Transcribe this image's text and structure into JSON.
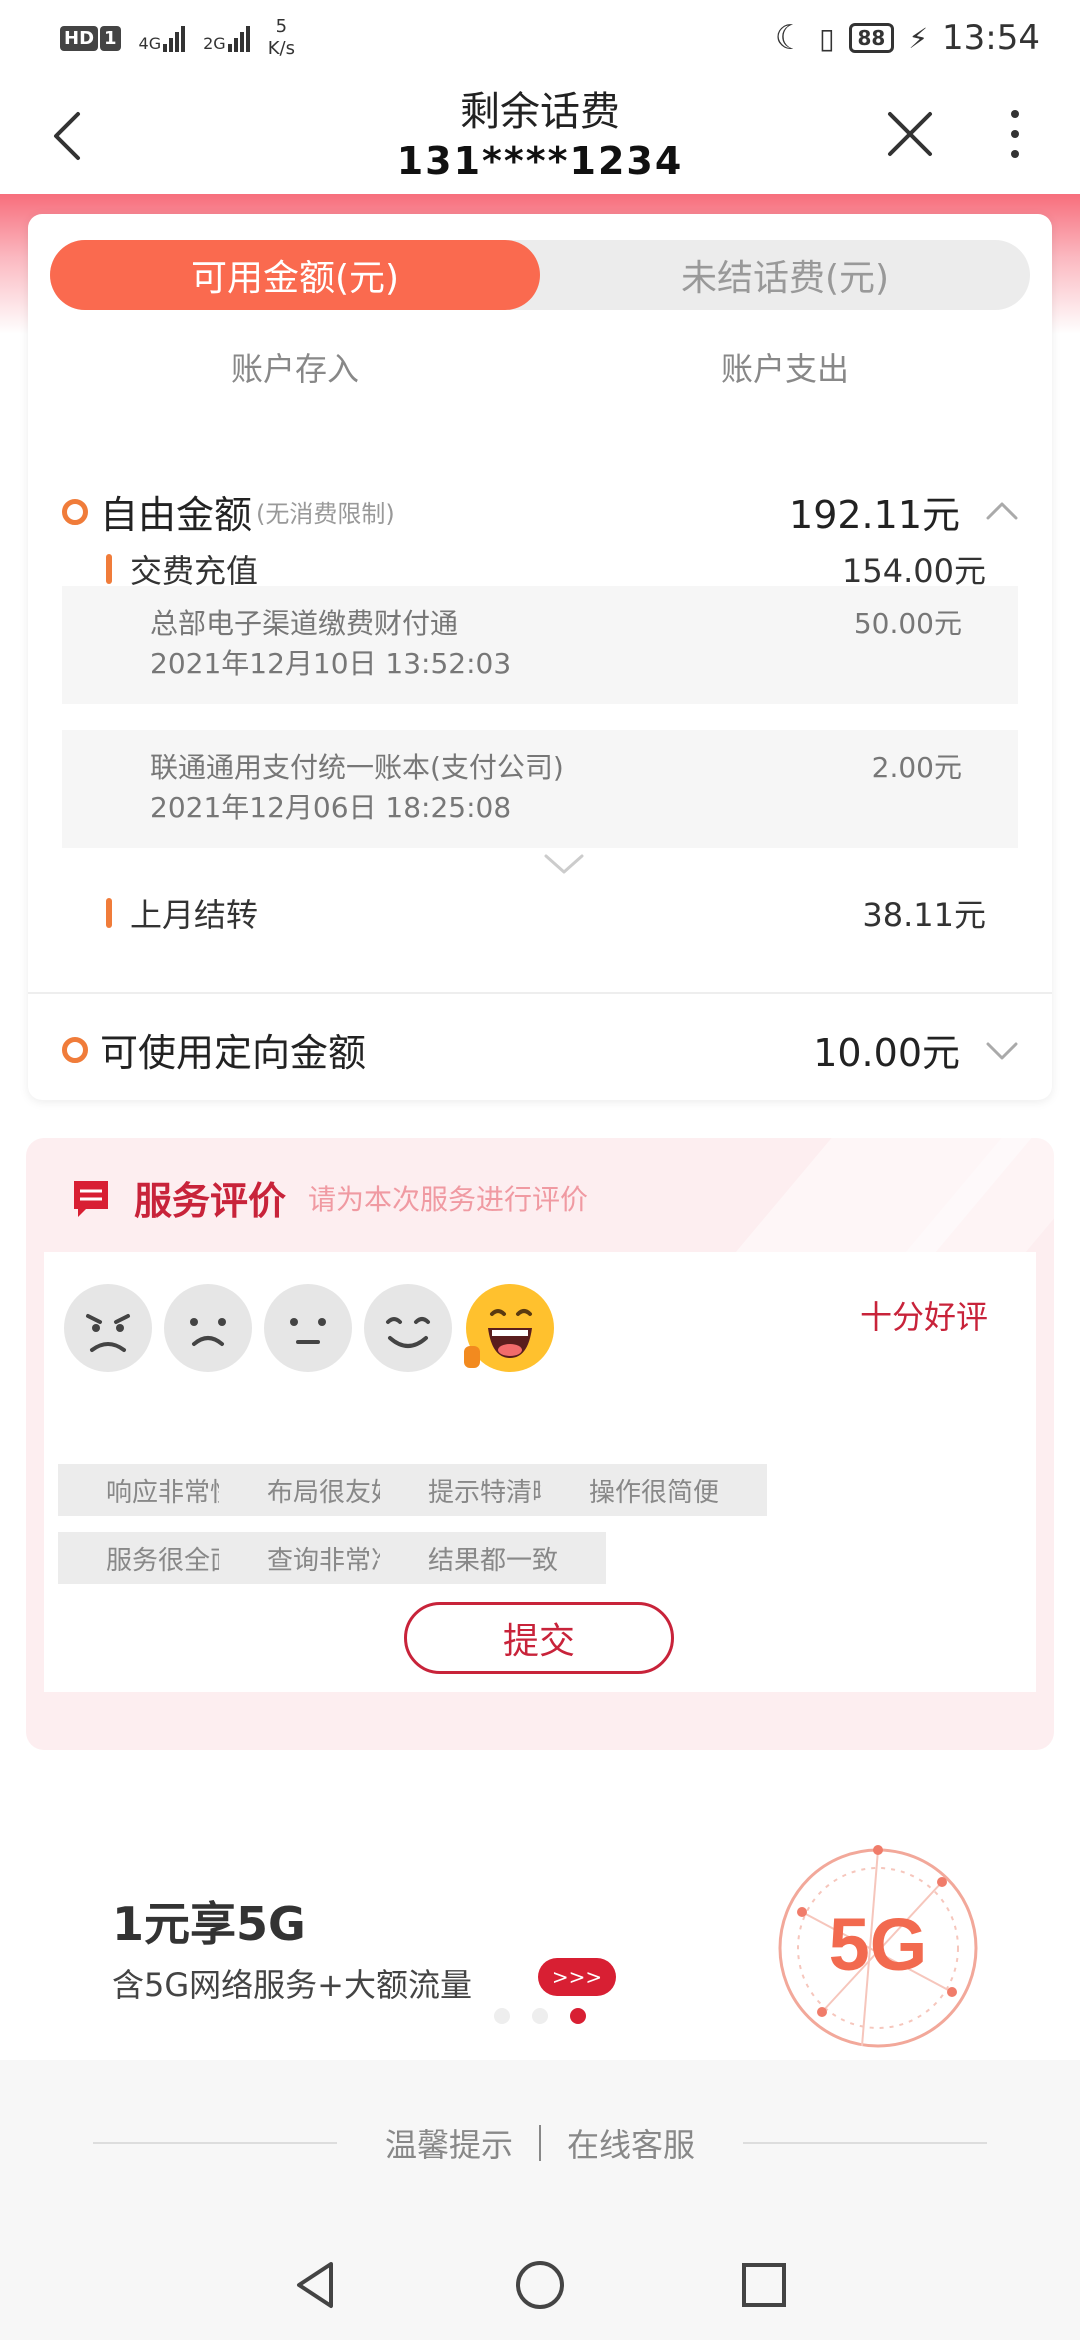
{
  "status_bar": {
    "hd_badge": "HD",
    "sim_badge": "1",
    "net1": "4G",
    "net2": "2G",
    "speed_value": "5",
    "speed_unit": "K/s",
    "battery": "88",
    "time": "13:54"
  },
  "header": {
    "title": "剩余话费",
    "phone": "131****1234"
  },
  "tabs": {
    "active": "可用金额(元)",
    "inactive": "未结话费(元)"
  },
  "subtabs": {
    "left": "账户存入",
    "right": "账户支出"
  },
  "free_amount": {
    "label": "自由金额",
    "note": "(无消费限制)",
    "amount": "192.11元",
    "recharge": {
      "label": "交费充值",
      "amount": "154.00元"
    },
    "transactions": [
      {
        "name": "总部电子渠道缴费财付通",
        "time": "2021年12月10日 13:52:03",
        "amount": "50.00元"
      },
      {
        "name": "联通通用支付统一账本(支付公司)",
        "time": "2021年12月06日 18:25:08",
        "amount": "2.00元"
      }
    ],
    "carryover": {
      "label": "上月结转",
      "amount": "38.11元"
    }
  },
  "directed_amount": {
    "label": "可使用定向金额",
    "amount": "10.00元"
  },
  "service_rating": {
    "title": "服务评价",
    "subtitle": "请为本次服务进行评价",
    "selected_label": "十分好评",
    "tags": [
      "响应非常快",
      "布局很友好",
      "提示特清晰",
      "操作很简便",
      "服务很全面",
      "查询非常准",
      "结果都一致"
    ],
    "submit_label": "提交"
  },
  "promo": {
    "title": "1元享5G",
    "subtitle": "含5G网络服务+大额流量",
    "button": ">>>",
    "art_text": "5G"
  },
  "footer": {
    "tips": "温馨提示",
    "service": "在线客服"
  },
  "colors": {
    "accent_orange": "#fa6a4f",
    "brand_red": "#c8233a",
    "ring_orange": "#f07c3a"
  }
}
